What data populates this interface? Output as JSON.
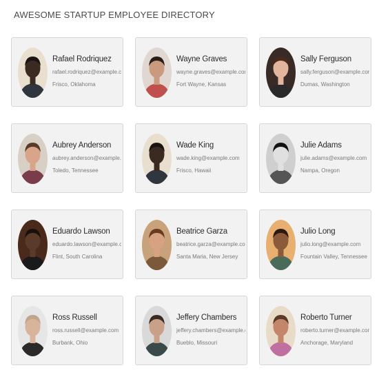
{
  "header": {
    "title": "AWESOME STARTUP EMPLOYEE DIRECTORY"
  },
  "employees": [
    {
      "name": "Rafael Rodriquez",
      "email": "rafael.rodriquez@example.com",
      "location": "Frisco, Oklahoma",
      "bg": "#e9dfcf",
      "skin": "#3b2a22",
      "hair": "#1c1410",
      "shirt": "#2f3640"
    },
    {
      "name": "Wayne Graves",
      "email": "wayne.graves@example.com",
      "location": "Fort Wayne, Kansas",
      "bg": "#e0d6d2",
      "skin": "#c99a7e",
      "hair": "#2a1d18",
      "shirt": "#c0504d"
    },
    {
      "name": "Sally Ferguson",
      "email": "sally.ferguson@example.com",
      "location": "Dumas, Washington",
      "bg": "#3a2a26",
      "skin": "#e2b49c",
      "hair": "#4a2a1c",
      "shirt": "#2a2a2a"
    },
    {
      "name": "Aubrey Anderson",
      "email": "aubrey.anderson@example.com",
      "location": "Toledo, Tennessee",
      "bg": "#d8cfc5",
      "skin": "#d9a58a",
      "hair": "#5a3a26",
      "shirt": "#7a3b4a"
    },
    {
      "name": "Wade King",
      "email": "wade.king@example.com",
      "location": "Frisco, Hawaii",
      "bg": "#e9dfcf",
      "skin": "#3b2a22",
      "hair": "#1c1410",
      "shirt": "#2f3640"
    },
    {
      "name": "Julie Adams",
      "email": "julie.adams@example.com",
      "location": "Nampa, Oregon",
      "bg": "#cfcfcf",
      "skin": "#e0e0e0",
      "hair": "#111111",
      "shirt": "#555555"
    },
    {
      "name": "Eduardo Lawson",
      "email": "eduardo.lawson@example.com",
      "location": "Flint, South Carolina",
      "bg": "#4a2a1a",
      "skin": "#5a3a28",
      "hair": "#1a100a",
      "shirt": "#1a1a1a"
    },
    {
      "name": "Beatrice Garza",
      "email": "beatrice.garza@example.com",
      "location": "Santa Maria, New Jersey",
      "bg": "#c8a27a",
      "skin": "#d7a282",
      "hair": "#6a3a1e",
      "shirt": "#7a5a3a"
    },
    {
      "name": "Julio Long",
      "email": "julio.long@example.com",
      "location": "Fountain Valley, Tennessee",
      "bg": "#e8b070",
      "skin": "#8a5a3a",
      "hair": "#2a1a10",
      "shirt": "#4a6a5a"
    },
    {
      "name": "Ross Russell",
      "email": "ross.russell@example.com",
      "location": "Burbank, Ohio",
      "bg": "#e6e6e6",
      "skin": "#d8b49a",
      "hair": "#bfa58a",
      "shirt": "#2a2a2a"
    },
    {
      "name": "Jeffery Chambers",
      "email": "jeffery.chambers@example.com",
      "location": "Bueblo, Missouri",
      "bg": "#d9d9d9",
      "skin": "#c9a088",
      "hair": "#3a2a22",
      "shirt": "#3a4a4a"
    },
    {
      "name": "Roberto Turner",
      "email": "roberto.turner@example.com",
      "location": "Anchorage, Maryland",
      "bg": "#e8dcc8",
      "skin": "#c4866a",
      "hair": "#5a3a2a",
      "shirt": "#c070a0"
    }
  ]
}
